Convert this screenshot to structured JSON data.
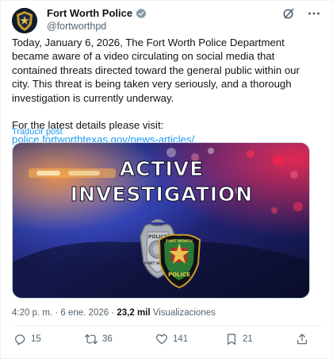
{
  "author": {
    "display_name": "Fort Worth Police",
    "handle": "@fortworthpd",
    "verified": true,
    "avatar_icon": "fort-worth-police-badge-icon"
  },
  "header_actions": {
    "grok_icon": "grok-icon",
    "more_icon": "more-icon"
  },
  "post": {
    "paragraph1": "Today, January 6, 2026, The Fort Worth Police Department became aware of a video circulating on social media that contained threats directed toward the general public within our city. This threat is being taken very seriously, and a thorough investigation is currently underway.",
    "paragraph2": "For the latest details please visit:",
    "link_text": "police.fortworthtexas.gov/news-articles/…",
    "translate_label": "Traducir post"
  },
  "media": {
    "headline_line1": "ACTIVE",
    "headline_line2": "INVESTIGATION",
    "badge_left_top": "POLICE",
    "badge_left_bottom": "FORT WORTH",
    "badge_right_top": "FORT WORTH",
    "badge_right_bottom": "POLICE"
  },
  "meta": {
    "time": "4:20 p. m.",
    "separator": " · ",
    "date": "6 ene. 2026",
    "views_count": "23,2 mil",
    "views_label": "Visualizaciones"
  },
  "actions": {
    "replies": "15",
    "reposts": "36",
    "likes": "141",
    "bookmarks": "21"
  },
  "colors": {
    "accent": "#1d9bf0",
    "muted": "#536471",
    "text": "#0f1419"
  }
}
